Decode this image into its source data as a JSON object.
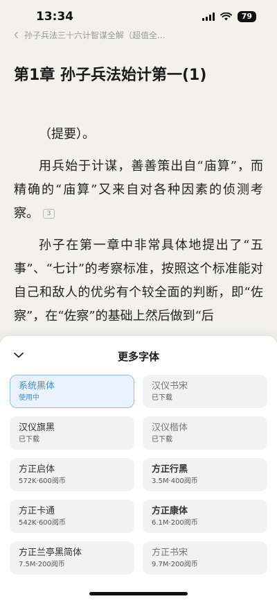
{
  "status_bar": {
    "time": "13:34",
    "battery": "79"
  },
  "reader": {
    "book_title": "孙子兵法三十六计智谋全解（超值全...",
    "chapter_title": "第1章 孙子兵法始计第一(1)",
    "paragraphs": [
      {
        "text": "（提要）。"
      },
      {
        "text": "用兵始于计谋，善善策出自“庙算”，而精确的“庙算”又来自对各种因素的侦测考察。",
        "note": "3"
      },
      {
        "text": "孙子在第一章中非常具体地提出了“五事”、“七计”的考察标准，按照这个标准能对自己和敌人的优劣有个较全面的判断，即“佐察”，在“佐察”的基础上然后做到“后"
      }
    ]
  },
  "font_sheet": {
    "title": "更多字体",
    "fonts": [
      {
        "name": "系统黑体",
        "status": "使用中",
        "selected": true
      },
      {
        "name": "汉仪书宋",
        "status": "已下载"
      },
      {
        "name": "汉仪旗黑",
        "status": "已下载"
      },
      {
        "name": "汉仪楷体",
        "status": "已下载"
      },
      {
        "name": "方正启体",
        "status": "572K·600阅币"
      },
      {
        "name": "方正行黑",
        "status": "3.5M·400阅币"
      },
      {
        "name": "方正卡通",
        "status": "542K·600阅币"
      },
      {
        "name": "方正康体",
        "status": "6.1M·200阅币"
      },
      {
        "name": "方正兰亭黑简体",
        "status": "7.5M·200阅币"
      },
      {
        "name": "方正书宋",
        "status": "9.7M·200阅币"
      }
    ]
  },
  "colors": {
    "accent": "#3e8edb",
    "background": "#f2f1ee",
    "sheet": "#ffffff",
    "card": "#f2f2f2"
  },
  "icons": {
    "back": "chevron-left-icon",
    "collapse": "chevron-down-icon",
    "wifi": "wifi-icon",
    "signal": "cellular-signal-icon",
    "battery": "battery-icon"
  }
}
